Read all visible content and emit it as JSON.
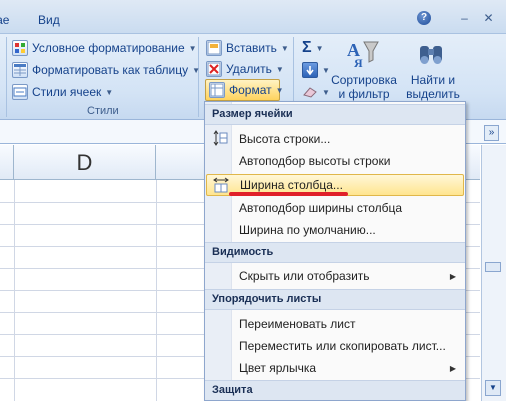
{
  "titlebar": {
    "tab_partial": "Дае",
    "tab_view": "Вид",
    "help": "?",
    "minimize": "–",
    "close": "✕"
  },
  "ribbon": {
    "styles": {
      "conditional": "Условное форматирование",
      "format_table": "Форматировать как таблицу",
      "cell_styles": "Стили ячеек",
      "group_label": "Стили"
    },
    "cells": {
      "insert": "Вставить",
      "delete": "Удалить",
      "format": "Формат"
    },
    "editing": {
      "sigma": "Σ",
      "sort_filter_1": "Сортировка",
      "sort_filter_2": "и фильтр",
      "find_select_1": "Найти и",
      "find_select_2": "выделить"
    }
  },
  "sheet": {
    "column_d": "D"
  },
  "menu": {
    "section_size": "Размер ячейки",
    "row_height": "Высота строки...",
    "autofit_row": "Автоподбор высоты строки",
    "col_width": "Ширина столбца...",
    "autofit_col": "Автоподбор ширины столбца",
    "default_width": "Ширина по умолчанию...",
    "section_visibility": "Видимость",
    "hide_show": "Скрыть или отобразить",
    "section_organize": "Упорядочить листы",
    "rename": "Переименовать лист",
    "move_copy": "Переместить или скопировать лист...",
    "tab_color": "Цвет ярлычка",
    "section_protect": "Защита"
  },
  "colors": {
    "accent_hover": "#ffe58f",
    "ribbon_text": "#15428b",
    "underline_red": "#e0202a"
  }
}
